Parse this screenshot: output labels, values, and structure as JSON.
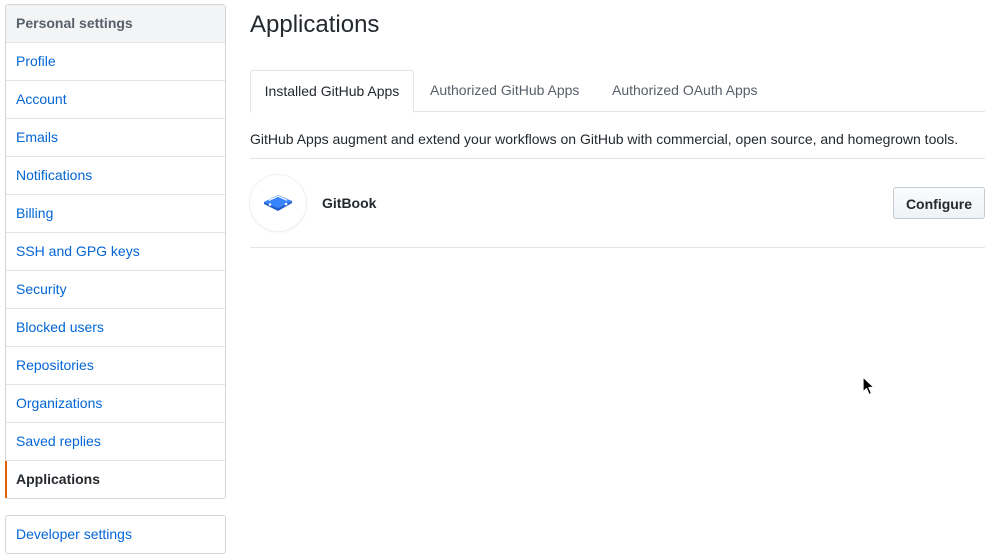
{
  "sidebar": {
    "heading": "Personal settings",
    "items": [
      {
        "label": "Profile"
      },
      {
        "label": "Account"
      },
      {
        "label": "Emails"
      },
      {
        "label": "Notifications"
      },
      {
        "label": "Billing"
      },
      {
        "label": "SSH and GPG keys"
      },
      {
        "label": "Security"
      },
      {
        "label": "Blocked users"
      },
      {
        "label": "Repositories"
      },
      {
        "label": "Organizations"
      },
      {
        "label": "Saved replies"
      },
      {
        "label": "Applications"
      }
    ],
    "selected_index": 11,
    "developer_settings": "Developer settings"
  },
  "main": {
    "title": "Applications",
    "tabs": [
      {
        "label": "Installed GitHub Apps"
      },
      {
        "label": "Authorized GitHub Apps"
      },
      {
        "label": "Authorized OAuth Apps"
      }
    ],
    "active_tab": 0,
    "description": "GitHub Apps augment and extend your workflows on GitHub with commercial, open source, and homegrown tools.",
    "apps": [
      {
        "name": "GitBook",
        "icon": "gitbook-icon",
        "action": "Configure"
      }
    ]
  },
  "colors": {
    "link": "#0366d6",
    "selected_marker": "#e36209",
    "gitbook_blue": "#3884ff"
  }
}
